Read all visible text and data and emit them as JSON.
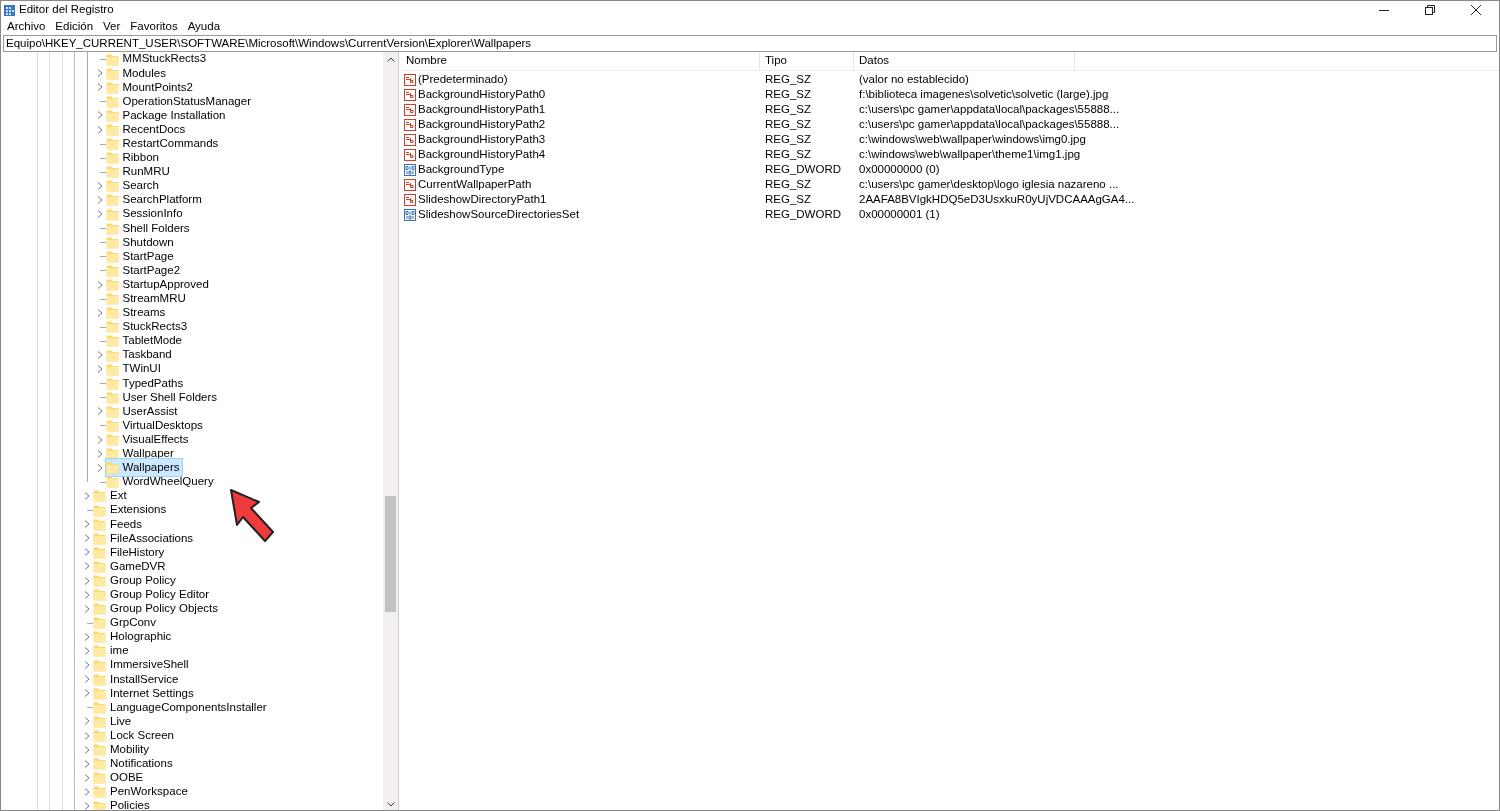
{
  "window": {
    "title": "Editor del Registro"
  },
  "menu": [
    "Archivo",
    "Edición",
    "Ver",
    "Favoritos",
    "Ayuda"
  ],
  "address": "Equipo\\HKEY_CURRENT_USER\\SOFTWARE\\Microsoft\\Windows\\CurrentVersion\\Explorer\\Wallpapers",
  "tree": {
    "nodes": [
      {
        "children": [
          {
            "label": "MMStuckRects3",
            "expandable": false,
            "selected": false
          },
          {
            "label": "Modules",
            "expandable": true,
            "selected": false
          },
          {
            "label": "MountPoints2",
            "expandable": true,
            "selected": false
          },
          {
            "label": "OperationStatusManager",
            "expandable": false,
            "selected": false
          },
          {
            "label": "Package Installation",
            "expandable": true,
            "selected": false
          },
          {
            "label": "RecentDocs",
            "expandable": true,
            "selected": false
          },
          {
            "label": "RestartCommands",
            "expandable": false,
            "selected": false
          },
          {
            "label": "Ribbon",
            "expandable": false,
            "selected": false
          },
          {
            "label": "RunMRU",
            "expandable": false,
            "selected": false
          },
          {
            "label": "Search",
            "expandable": true,
            "selected": false
          },
          {
            "label": "SearchPlatform",
            "expandable": true,
            "selected": false
          },
          {
            "label": "SessionInfo",
            "expandable": true,
            "selected": false
          },
          {
            "label": "Shell Folders",
            "expandable": false,
            "selected": false
          },
          {
            "label": "Shutdown",
            "expandable": false,
            "selected": false
          },
          {
            "label": "StartPage",
            "expandable": false,
            "selected": false
          },
          {
            "label": "StartPage2",
            "expandable": false,
            "selected": false
          },
          {
            "label": "StartupApproved",
            "expandable": true,
            "selected": false
          },
          {
            "label": "StreamMRU",
            "expandable": false,
            "selected": false
          },
          {
            "label": "Streams",
            "expandable": true,
            "selected": false
          },
          {
            "label": "StuckRects3",
            "expandable": false,
            "selected": false
          },
          {
            "label": "TabletMode",
            "expandable": false,
            "selected": false
          },
          {
            "label": "Taskband",
            "expandable": true,
            "selected": false
          },
          {
            "label": "TWinUI",
            "expandable": true,
            "selected": false
          },
          {
            "label": "TypedPaths",
            "expandable": false,
            "selected": false
          },
          {
            "label": "User Shell Folders",
            "expandable": false,
            "selected": false
          },
          {
            "label": "UserAssist",
            "expandable": true,
            "selected": false
          },
          {
            "label": "VirtualDesktops",
            "expandable": false,
            "selected": false
          },
          {
            "label": "VisualEffects",
            "expandable": true,
            "selected": false
          },
          {
            "label": "Wallpaper",
            "expandable": true,
            "selected": false
          },
          {
            "label": "Wallpapers",
            "expandable": true,
            "selected": true
          },
          {
            "label": "WordWheelQuery",
            "expandable": false,
            "selected": false
          }
        ]
      },
      {
        "label": "Ext",
        "expandable": true,
        "selected": false
      },
      {
        "label": "Extensions",
        "expandable": false,
        "selected": false
      },
      {
        "label": "Feeds",
        "expandable": true,
        "selected": false
      },
      {
        "label": "FileAssociations",
        "expandable": true,
        "selected": false
      },
      {
        "label": "FileHistory",
        "expandable": true,
        "selected": false
      },
      {
        "label": "GameDVR",
        "expandable": true,
        "selected": false
      },
      {
        "label": "Group Policy",
        "expandable": true,
        "selected": false
      },
      {
        "label": "Group Policy Editor",
        "expandable": true,
        "selected": false
      },
      {
        "label": "Group Policy Objects",
        "expandable": true,
        "selected": false
      },
      {
        "label": "GrpConv",
        "expandable": false,
        "selected": false
      },
      {
        "label": "Holographic",
        "expandable": true,
        "selected": false
      },
      {
        "label": "ime",
        "expandable": true,
        "selected": false
      },
      {
        "label": "ImmersiveShell",
        "expandable": true,
        "selected": false
      },
      {
        "label": "InstallService",
        "expandable": true,
        "selected": false
      },
      {
        "label": "Internet Settings",
        "expandable": true,
        "selected": false
      },
      {
        "label": "LanguageComponentsInstaller",
        "expandable": false,
        "selected": false
      },
      {
        "label": "Live",
        "expandable": true,
        "selected": false
      },
      {
        "label": "Lock Screen",
        "expandable": true,
        "selected": false
      },
      {
        "label": "Mobility",
        "expandable": true,
        "selected": false
      },
      {
        "label": "Notifications",
        "expandable": true,
        "selected": false
      },
      {
        "label": "OOBE",
        "expandable": true,
        "selected": false
      },
      {
        "label": "PenWorkspace",
        "expandable": true,
        "selected": false
      },
      {
        "label": "Policies",
        "expandable": true,
        "selected": false
      }
    ]
  },
  "values_table": {
    "columns": [
      "Nombre",
      "Tipo",
      "Datos"
    ],
    "rows": [
      {
        "kind": "string",
        "name": "(Predeterminado)",
        "type": "REG_SZ",
        "data": "(valor no establecido)"
      },
      {
        "kind": "string",
        "name": "BackgroundHistoryPath0",
        "type": "REG_SZ",
        "data": "f:\\biblioteca imagenes\\solvetic\\solvetic (large).jpg"
      },
      {
        "kind": "string",
        "name": "BackgroundHistoryPath1",
        "type": "REG_SZ",
        "data": "c:\\users\\pc gamer\\appdata\\local\\packages\\55888..."
      },
      {
        "kind": "string",
        "name": "BackgroundHistoryPath2",
        "type": "REG_SZ",
        "data": "c:\\users\\pc gamer\\appdata\\local\\packages\\55888..."
      },
      {
        "kind": "string",
        "name": "BackgroundHistoryPath3",
        "type": "REG_SZ",
        "data": "c:\\windows\\web\\wallpaper\\windows\\img0.jpg"
      },
      {
        "kind": "string",
        "name": "BackgroundHistoryPath4",
        "type": "REG_SZ",
        "data": "c:\\windows\\web\\wallpaper\\theme1\\img1.jpg"
      },
      {
        "kind": "binary",
        "name": "BackgroundType",
        "type": "REG_DWORD",
        "data": "0x00000000 (0)"
      },
      {
        "kind": "string",
        "name": "CurrentWallpaperPath",
        "type": "REG_SZ",
        "data": "c:\\users\\pc gamer\\desktop\\logo iglesia nazareno ..."
      },
      {
        "kind": "string",
        "name": "SlideshowDirectoryPath1",
        "type": "REG_SZ",
        "data": "2AAFA8BVIgkHDQ5eD3UsxkuR0yUjVDCAAAgGA4..."
      },
      {
        "kind": "binary",
        "name": "SlideshowSourceDirectoriesSet",
        "type": "REG_DWORD",
        "data": "0x00000001 (1)"
      }
    ]
  }
}
